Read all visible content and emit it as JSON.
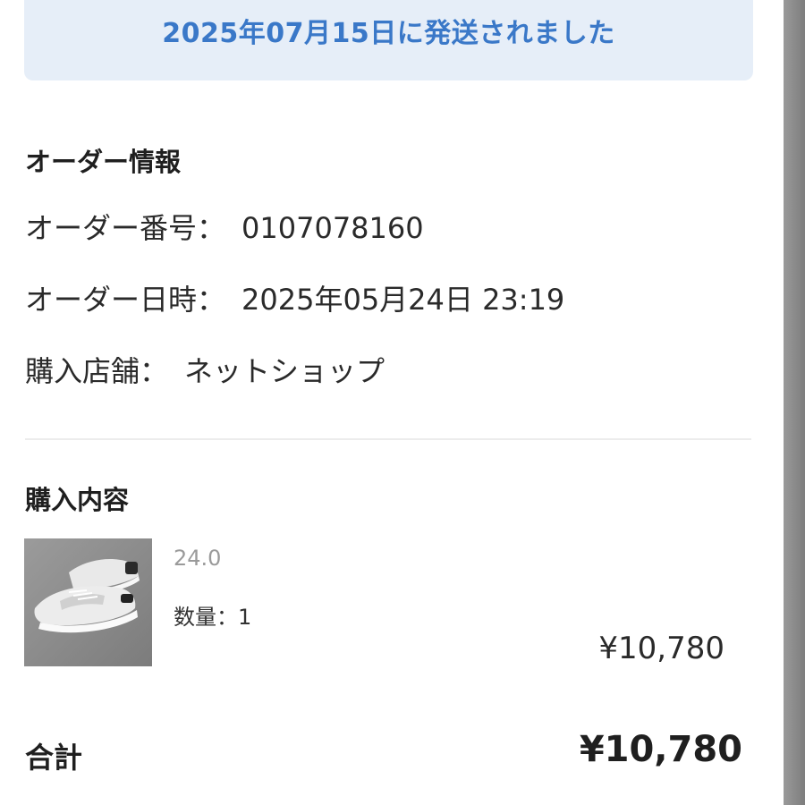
{
  "shipping_banner": {
    "text": "2025年07月15日に発送されました"
  },
  "order_info": {
    "title": "オーダー情報",
    "order_number_label": "オーダー番号：",
    "order_number": "0107078160",
    "order_datetime_label": "オーダー日時：",
    "order_datetime": "2025年05月24日 23:19",
    "store_label": "購入店舗：",
    "store": "ネットショップ"
  },
  "purchase": {
    "title": "購入内容",
    "items": [
      {
        "image": "white-sneakers-photo",
        "size": "24.0",
        "quantity_text": "数量：1",
        "price": "¥10,780"
      }
    ]
  },
  "total": {
    "label": "合計",
    "value": "¥10,780"
  },
  "colors": {
    "banner_bg": "#e6eef8",
    "banner_text": "#3a78c8"
  }
}
